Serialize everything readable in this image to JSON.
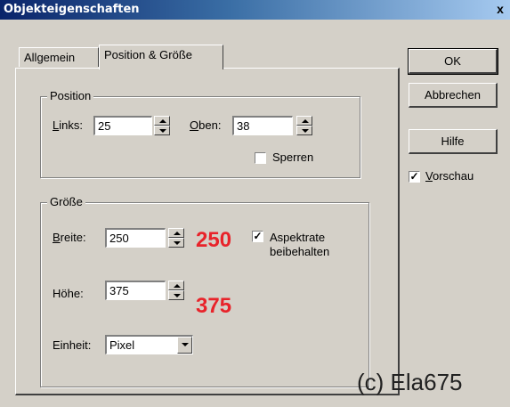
{
  "window": {
    "title": "Objekteigenschaften",
    "close": "x"
  },
  "tabs": [
    {
      "label": "Allgemein"
    },
    {
      "label": "Position & Größe"
    }
  ],
  "position_group": {
    "label": "Position",
    "links_label": "Links:",
    "links_value": "25",
    "oben_label": "Oben:",
    "oben_value": "38",
    "sperren_label": "Sperren",
    "sperren_checked": false
  },
  "size_group": {
    "label": "Größe",
    "breite_label": "Breite:",
    "breite_value": "250",
    "hoehe_label": "Höhe:",
    "hoehe_value": "375",
    "aspect_label_line1": "Aspektrate",
    "aspect_label_line2": "beibehalten",
    "aspect_checked": true,
    "einheit_label": "Einheit:",
    "einheit_value": "Pixel"
  },
  "buttons": {
    "ok": "OK",
    "cancel": "Abbrechen",
    "help": "Hilfe"
  },
  "preview": {
    "label": "Vorschau",
    "checked": true
  },
  "annotations": {
    "breite": "250",
    "hoehe": "375",
    "color": "#e8232a"
  },
  "watermark": "(c) Ela675",
  "colors": {
    "dialog_bg": "#d4d0c8",
    "title_start": "#0a246a",
    "title_end": "#a6caf0"
  }
}
